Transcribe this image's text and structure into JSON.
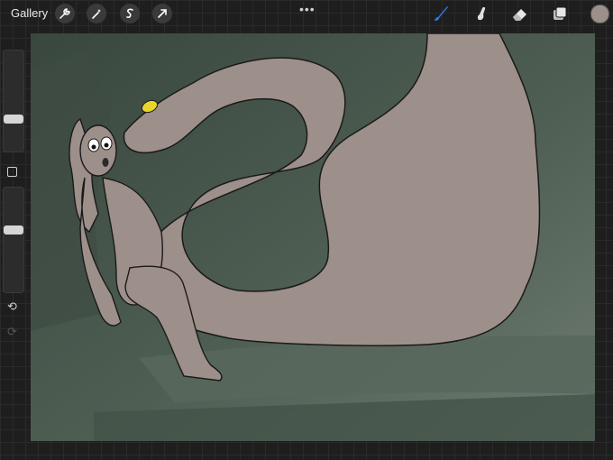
{
  "app": {
    "gallery_label": "Gallery",
    "more_label": "•••"
  },
  "toolbar": {
    "left_tools": [
      "wrench-icon",
      "magic-wand-icon",
      "selection-icon",
      "transform-arrow-icon"
    ],
    "right_tools": [
      "brush-icon",
      "smudge-icon",
      "eraser-icon",
      "layers-icon"
    ],
    "active_tool": "brush-icon",
    "active_color": "#9d8f8a",
    "accent_color": "#2d7be3"
  },
  "sidebar": {
    "brush_size_level": 0.3,
    "opacity_level": 0.6
  },
  "canvas": {
    "background_color": "#4e5e52",
    "snake_color": "#9d8f8a",
    "eye_color": "#e6d82a"
  }
}
